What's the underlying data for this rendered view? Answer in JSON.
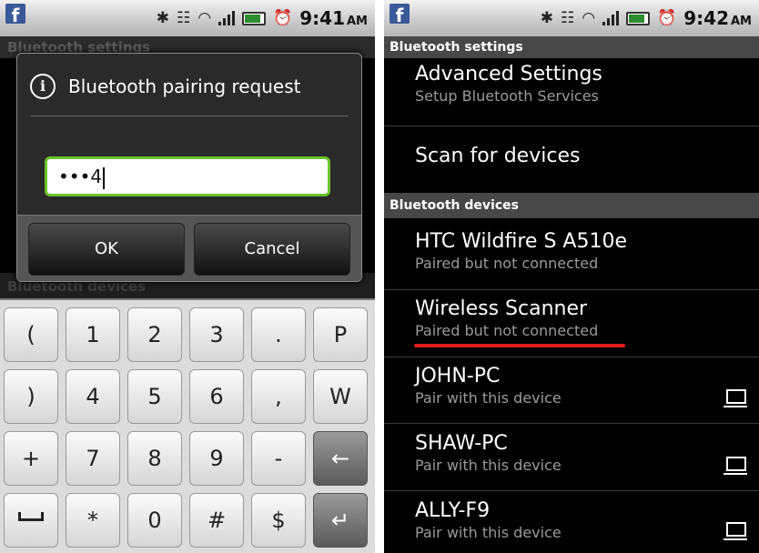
{
  "left": {
    "status": {
      "time": "9:41",
      "ampm": "AM"
    },
    "bg_header_1": "Bluetooth settings",
    "bg_header_2": "Bluetooth devices",
    "dialog": {
      "title": "Bluetooth pairing request",
      "pin_value": "•••4",
      "ok_label": "OK",
      "cancel_label": "Cancel"
    },
    "keyboard": {
      "row1": [
        "(",
        "1",
        "2",
        "3",
        ".",
        "P"
      ],
      "row2": [
        ")",
        "4",
        "5",
        "6",
        ",",
        "W"
      ],
      "row3": [
        "+",
        "7",
        "8",
        "9",
        "-",
        "←"
      ],
      "row4": [
        "",
        "*",
        "0",
        "#",
        "$",
        "↵"
      ]
    }
  },
  "right": {
    "status": {
      "time": "9:42",
      "ampm": "AM"
    },
    "header_settings": "Bluetooth settings",
    "advanced": {
      "title": "Advanced Settings",
      "subtitle": "Setup Bluetooth Services"
    },
    "scan": {
      "title": "Scan for devices"
    },
    "header_devices": "Bluetooth devices",
    "devices": [
      {
        "name": "HTC Wildfire S A510e",
        "status": "Paired but not connected"
      },
      {
        "name": "Wireless Scanner",
        "status": "Paired but not connected"
      },
      {
        "name": "JOHN-PC",
        "status": "Pair with this device"
      },
      {
        "name": "SHAW-PC",
        "status": "Pair with this device"
      },
      {
        "name": "ALLY-F9",
        "status": "Pair with this device"
      }
    ]
  },
  "colors": {
    "accent_green": "#6cc22b",
    "highlight_red": "#e01b1b",
    "section_header": "#474747"
  },
  "icons": [
    "facebook-icon",
    "bluetooth-icon",
    "vibrate-icon",
    "wifi-icon",
    "signal-icon",
    "battery-icon",
    "alarm-icon",
    "info-icon",
    "computer-icon",
    "backspace-icon",
    "enter-icon",
    "space-icon"
  ]
}
